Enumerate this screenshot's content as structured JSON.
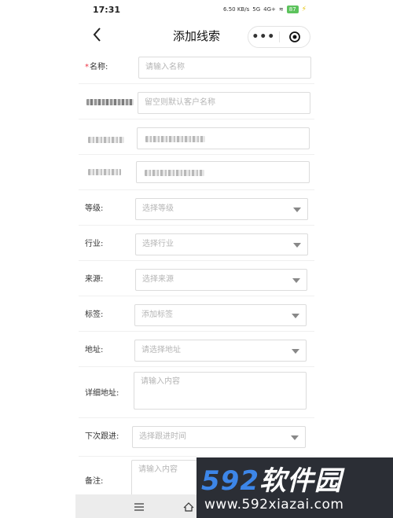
{
  "status_bar": {
    "time": "17:31",
    "net_speed": "6.50 KB/s",
    "signal_1": "5G",
    "signal_2": "4G+",
    "battery": "87"
  },
  "nav": {
    "title": "添加线索",
    "more_label": "•••",
    "icons": {
      "back": "chevron-left-icon",
      "close": "target-icon"
    }
  },
  "form": {
    "required_mark": "*",
    "name": {
      "label": "名称:",
      "placeholder": "请输入名称"
    },
    "contact": {
      "placeholder": "留空则默认客户名称"
    },
    "level": {
      "label": "等级:",
      "placeholder": "选择等级"
    },
    "industry": {
      "label": "行业:",
      "placeholder": "选择行业"
    },
    "source": {
      "label": "来源:",
      "placeholder": "选择来源"
    },
    "tags": {
      "label": "标签:",
      "placeholder": "添加标签"
    },
    "address": {
      "label": "地址:",
      "placeholder": "请选择地址"
    },
    "detail_address": {
      "label": "详细地址:",
      "placeholder": "请输入内容"
    },
    "next_followup": {
      "label": "下次跟进:",
      "placeholder": "选择跟进时间"
    },
    "remark": {
      "label": "备注:",
      "placeholder": "请输入内容"
    }
  },
  "watermark": {
    "brand_num": "592",
    "brand_cn": "软件园",
    "url": "www.592xiazai.com"
  },
  "colors": {
    "battery": "#5cc35c",
    "watermark_bg": "#2b2e35",
    "watermark_accent": "#3d86e8",
    "required": "#e34"
  }
}
